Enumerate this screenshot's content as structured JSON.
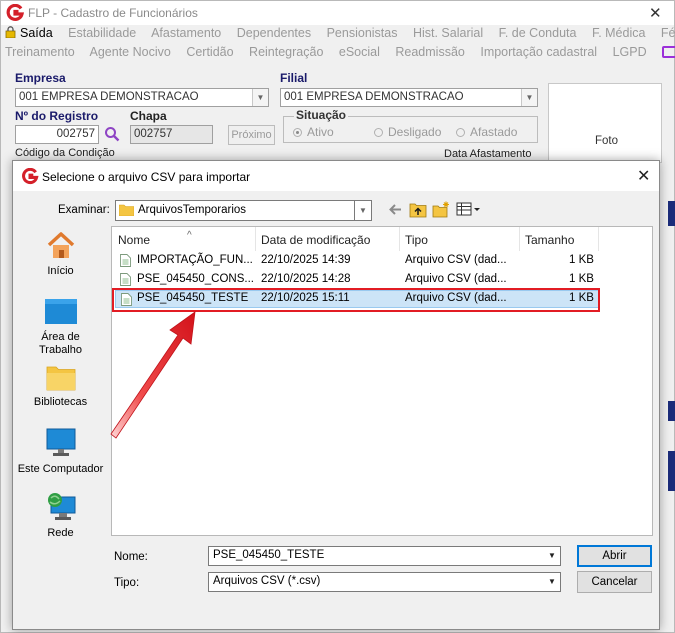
{
  "app": {
    "title": "FLP - Cadastro de Funcionários",
    "menu_row1": [
      "Saída",
      "Estabilidade",
      "Afastamento",
      "Dependentes",
      "Pensionistas",
      "Hist. Salarial",
      "F. de Conduta",
      "F. Médica",
      "Férias"
    ],
    "menu_row2": [
      "Treinamento",
      "Agente Nocivo",
      "Certidão",
      "Reintegração",
      "eSocial",
      "Readmissão",
      "Importação cadastral",
      "LGPD"
    ],
    "form": {
      "empresa_label": "Empresa",
      "empresa_value": "001 EMPRESA DEMONSTRACAO",
      "filial_label": "Filial",
      "filial_value": "001 EMPRESA DEMONSTRACAO",
      "registro_label": "Nº do Registro",
      "registro_value": "002757",
      "chapa_label": "Chapa",
      "chapa_value": "002757",
      "proximo_label": "Próximo",
      "situacao_label": "Situação",
      "situacao_options": [
        "Ativo",
        "Desligado",
        "Afastado"
      ],
      "situacao_selected": "Ativo",
      "codigo_condicao_label": "Código da Condição",
      "data_afastamento_label": "Data Afastamento",
      "foto_label": "Foto"
    }
  },
  "dialog": {
    "title": "Selecione o arquivo CSV para importar",
    "look_in_label": "Examinar:",
    "look_in_value": "ArquivosTemporarios",
    "places": [
      {
        "label": "Início",
        "icon": "home-icon"
      },
      {
        "label": "Área de Trabalho",
        "icon": "desktop-icon"
      },
      {
        "label": "Bibliotecas",
        "icon": "libraries-icon"
      },
      {
        "label": "Este Computador",
        "icon": "computer-icon"
      },
      {
        "label": "Rede",
        "icon": "network-icon"
      }
    ],
    "columns": [
      "Nome",
      "Data de modificação",
      "Tipo",
      "Tamanho"
    ],
    "files": [
      {
        "name": "IMPORTAÇÃO_FUN...",
        "modified": "22/10/2025 14:39",
        "type": "Arquivo CSV (dad...",
        "size": "1 KB"
      },
      {
        "name": "PSE_045450_CONS...",
        "modified": "22/10/2025 14:28",
        "type": "Arquivo CSV (dad...",
        "size": "1 KB"
      },
      {
        "name": "PSE_045450_TESTE",
        "modified": "22/10/2025 15:11",
        "type": "Arquivo CSV (dad...",
        "size": "1 KB"
      }
    ],
    "selected_file_index": 2,
    "file_name_label": "Nome:",
    "file_name_value": "PSE_045450_TESTE",
    "file_type_label": "Tipo:",
    "file_type_value": "Arquivos CSV (*.csv)",
    "open_button": "Abrir",
    "cancel_button": "Cancelar"
  },
  "colors": {
    "highlight": "#e21c24",
    "selection": "#cce4f7",
    "accent_purple": "#9b30d9"
  }
}
